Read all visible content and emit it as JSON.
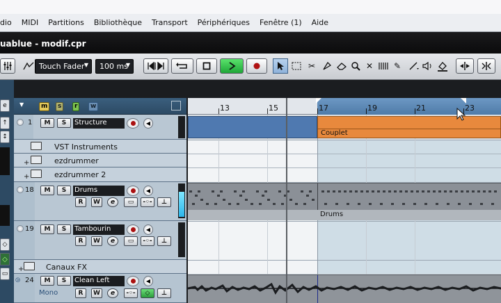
{
  "menubar": {
    "items": [
      "dio",
      "MIDI",
      "Partitions",
      "Bibliothèque",
      "Transport",
      "Périphériques",
      "Fenêtre (1)",
      "Aide"
    ]
  },
  "titlebar": {
    "title": "uablue - modif.cpr"
  },
  "toolbar": {
    "automation_mode": "Touch Fader",
    "latency": "100 ms"
  },
  "tracklist_header": {
    "buttons": [
      "m",
      "s",
      "r",
      "w"
    ]
  },
  "ruler": {
    "bars": [
      "13",
      "15",
      "17",
      "19",
      "21",
      "23"
    ]
  },
  "tracks": [
    {
      "kind": "marker",
      "name": "Structure",
      "number": "1"
    },
    {
      "kind": "folder",
      "name": "VST Instruments"
    },
    {
      "kind": "folder",
      "name": "ezdrummer"
    },
    {
      "kind": "folder",
      "name": "ezdrummer 2"
    },
    {
      "kind": "instrument",
      "number": "18",
      "name": "Drums"
    },
    {
      "kind": "instrument",
      "number": "19",
      "name": "Tambourin"
    },
    {
      "kind": "folder",
      "name": "Canaux FX"
    },
    {
      "kind": "audio",
      "number": "24",
      "name": "Clean Left",
      "mode": "Mono"
    }
  ],
  "buttons": {
    "mute": "M",
    "solo": "S",
    "read": "R",
    "write": "W",
    "edit": "e"
  },
  "parts": {
    "marker_part": "Couplet",
    "drums_part": "Drums"
  },
  "colors": {
    "accent_blue": "#4f79b0",
    "marker_orange": "#e8893d",
    "record_red": "#aa1111",
    "play_green": "#30c54a",
    "level_cyan": "#3cc8f0"
  }
}
